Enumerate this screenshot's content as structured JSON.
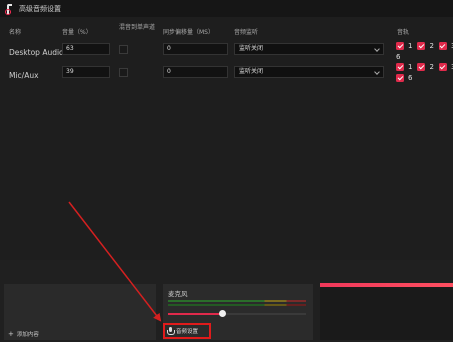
{
  "window": {
    "title": "高级音频设置"
  },
  "columns": {
    "name": "名称",
    "volume": "音量（%）",
    "mono": "混音到单声道",
    "sync_offset": "同步偏移量（MS）",
    "monitoring": "音频监听",
    "tracks": "音轨"
  },
  "rows": [
    {
      "name": "Desktop Audio",
      "volume": "63",
      "sync_offset": "0",
      "monitoring": "监听关闭",
      "tracks": [
        "1",
        "2",
        "3",
        "4",
        "5",
        "6"
      ]
    },
    {
      "name": "Mic/Aux",
      "volume": "39",
      "sync_offset": "0",
      "monitoring": "监听关闭",
      "tracks": [
        "1",
        "2",
        "3",
        "4",
        "5",
        "6"
      ]
    }
  ],
  "bottom": {
    "add_scene": "添加内容",
    "mic_source": "麦克风",
    "mic_volume_fraction": 0.37,
    "audio_settings": "音频设置"
  },
  "colors": {
    "accent": "#e02a4b",
    "highlight_box": "#e01b1b",
    "arrow": "#d42020"
  },
  "icons": {
    "app": "app-logo-icon",
    "add": "plus-icon",
    "audio_settings": "microphone-icon",
    "dropdown": "chevron-down-icon",
    "checkbox": "checkbox-checked-icon"
  }
}
